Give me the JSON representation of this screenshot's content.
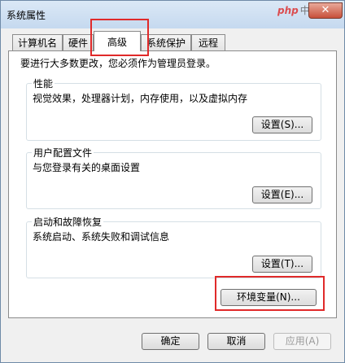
{
  "window": {
    "title": "系统属性",
    "close_label": "✕"
  },
  "watermark": {
    "brand": "php",
    "suffix": "中文网"
  },
  "tabs": [
    {
      "label": "计算机名"
    },
    {
      "label": "硬件"
    },
    {
      "label": "高级"
    },
    {
      "label": "系统保护"
    },
    {
      "label": "远程"
    }
  ],
  "active_tab": "高级",
  "notice": "要进行大多数更改，您必须作为管理员登录。",
  "performance": {
    "title": "性能",
    "description": "视觉效果，处理器计划，内存使用，以及虚拟内存",
    "button": "设置(S)..."
  },
  "user_profiles": {
    "title": "用户配置文件",
    "description": "与您登录有关的桌面设置",
    "button": "设置(E)..."
  },
  "startup_recovery": {
    "title": "启动和故障恢复",
    "description": "系统启动、系统失败和调试信息",
    "button": "设置(T)..."
  },
  "env_button": "环境变量(N)...",
  "footer": {
    "ok": "确定",
    "cancel": "取消",
    "apply": "应用(A)"
  },
  "colors": {
    "highlight": "#e02a2a",
    "titlebar": "#c5d9ef",
    "close": "#c7503a"
  }
}
